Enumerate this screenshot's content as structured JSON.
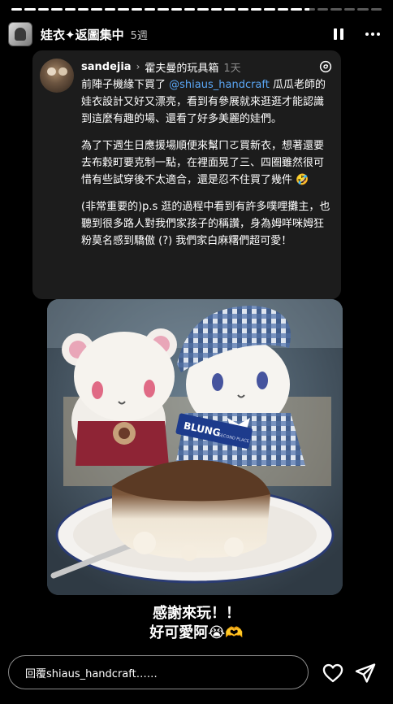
{
  "story": {
    "progress_segments": [
      1,
      1,
      1,
      1,
      1,
      1,
      1,
      1,
      1,
      1,
      1,
      1,
      1,
      1,
      1,
      1,
      1,
      1,
      1,
      1,
      1,
      1,
      0.5,
      0,
      0,
      0,
      0,
      0
    ],
    "account_name": "娃衣✦返圖集中",
    "posted_ago": "5週",
    "pause_icon": "pause-icon",
    "more_icon": "more-options-icon"
  },
  "thread_card": {
    "username": "sandejia",
    "topic": "霍夫曼的玩具箱",
    "posted_ago": "1天",
    "brand_icon": "threads-logo-icon",
    "paragraph_1_before": "前陣子機緣下買了 ",
    "paragraph_1_mention": "@shiaus_handcraft",
    "paragraph_1_after": " 瓜瓜老師的娃衣設計又好又漂亮，看到有參展就來逛逛才能認識到這麼有趣的場、還看了好多美麗的娃們。",
    "paragraph_2": "為了下週生日應援場順便來幫ㄇㄛ買新衣，想著還要去布穀町要克制一點，在裡面晃了三、四圈雖然很可惜有些試穿後不太適合，還是忍不住買了幾件 🤣",
    "paragraph_3": "(非常重要的)p.s 逛的過程中看到有許多噗哩攤主，也聽到很多路人對我們家孩子的稱讚，身為姆咩咪姆狂粉莫名感到驕傲 (?) 我們家白麻糬們超可愛！"
  },
  "photo": {
    "cafe_sign_text": "BLUNG",
    "cafe_sign_subtext": "SECOND PLACE"
  },
  "caption": {
    "line_1": "感謝來玩！！",
    "line_2": "好可愛阿😭🫶"
  },
  "reply_bar": {
    "placeholder": "回覆shiaus_handcraft……",
    "like_icon": "heart-icon",
    "share_icon": "send-icon"
  },
  "colors": {
    "background": "#000000",
    "card": "#1c1c1c",
    "mention": "#5aa6f5"
  }
}
